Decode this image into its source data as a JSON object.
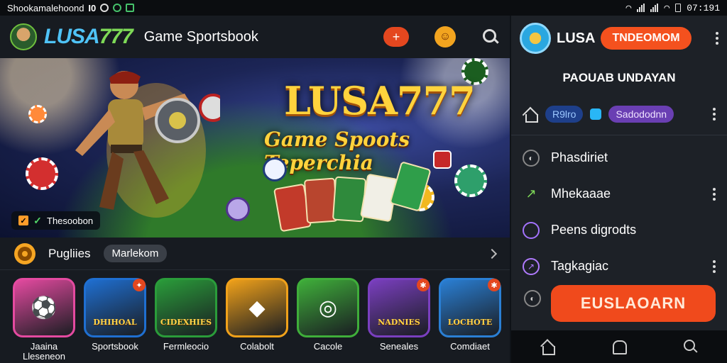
{
  "status_bar": {
    "app_text": "Shookamalehoond",
    "indicator": "I0",
    "time": "07:191"
  },
  "header": {
    "brand_prefix": "LUSA",
    "brand_number": "777",
    "title": "Game Sportsbook",
    "action_glyph": "+"
  },
  "hero": {
    "headline": "LUSA777",
    "subline": "Game Spoots Teperchia",
    "badge_text": "Thesoobon"
  },
  "category_row": {
    "label": "Pugliies",
    "pill": "Marlekom"
  },
  "games": [
    {
      "name": "Jaaina Lleseneon",
      "art_text": "",
      "badge": "",
      "bg": "#e44aa0"
    },
    {
      "name": "Sportsbook",
      "art_text": "DHIHOAL",
      "badge": "✦",
      "bg": "#1f6fd1"
    },
    {
      "name": "Fermleocio",
      "art_text": "CIDEXHIES",
      "badge": "",
      "bg": "#2a9c3a"
    },
    {
      "name": "Colabolt",
      "art_text": "",
      "badge": "",
      "bg": "#f0a11a"
    },
    {
      "name": "Cacole",
      "art_text": "",
      "badge": "",
      "bg": "#3fae3a"
    },
    {
      "name": "Seneales",
      "art_text": "NADNIES",
      "badge": "✱",
      "bg": "#7a3fbf"
    },
    {
      "name": "Comdiaet",
      "art_text": "LOCHOTE",
      "badge": "✱",
      "bg": "#2a7fd4"
    }
  ],
  "side_panel": {
    "brand": "LUSA",
    "cta": "TNDEOMOM",
    "heading": "PAOUAB UNDAYAN",
    "tabs": [
      "R9lro",
      "Sadododnn"
    ],
    "menu": [
      {
        "label": "Phasdiriet",
        "icon": "settings-icon",
        "has_more": false
      },
      {
        "label": "Mhekaaae",
        "icon": "chart-icon",
        "has_more": true
      },
      {
        "label": "Peens digrodts",
        "icon": "circle-icon",
        "has_more": false
      },
      {
        "label": "Tagkagiac",
        "icon": "link-icon",
        "has_more": true
      }
    ],
    "action_button": "EUSLAOARN"
  },
  "colors": {
    "accent": "#f04a1c",
    "brand_blue": "#4fc3f7",
    "brand_green": "#7ed957",
    "headline_gold": "#ffd33d"
  }
}
